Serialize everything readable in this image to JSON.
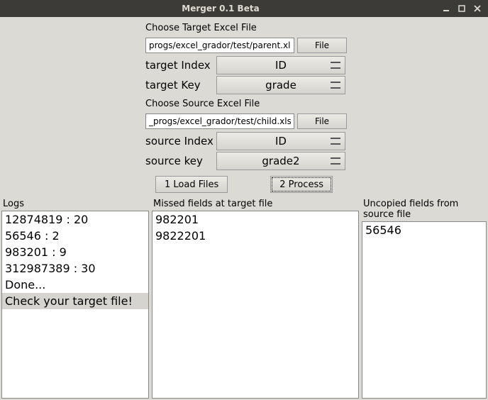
{
  "window": {
    "title": "Merger 0.1 Beta"
  },
  "form": {
    "target_section_label": "Choose Target Excel File",
    "target_path": "progs/excel_grador/test/parent.xlsx",
    "file_button": "File",
    "target_index_label": "target Index",
    "target_index_value": "ID",
    "target_key_label": "target Key",
    "target_key_value": "grade",
    "source_section_label": "Choose Source Excel File",
    "source_path": "_progs/excel_grador/test/child.xlsx",
    "source_index_label": "source Index",
    "source_index_value": "ID",
    "source_key_label": "source key",
    "source_key_value": "grade2",
    "load_button": "1 Load Files",
    "process_button": "2 Process"
  },
  "panels": {
    "logs_header": "Logs",
    "logs": [
      "12874819 : 20",
      "56546 : 2",
      "983201 : 9",
      "312987389 : 30",
      "Done...",
      "Check your target file!"
    ],
    "missed_header": "Missed fields at target file",
    "missed": [
      "982201",
      "9822201"
    ],
    "uncopied_header": "Uncopied fields from source file",
    "uncopied": [
      "56546"
    ]
  }
}
